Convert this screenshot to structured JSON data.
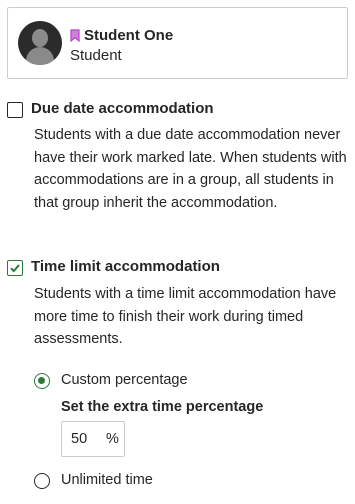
{
  "user": {
    "name": "Student One",
    "role": "Student",
    "bookmark_color": "#b045c2"
  },
  "due_date": {
    "title": "Due date accommodation",
    "checked": false,
    "description": "Students with a due date accommodation never have their work marked late. When students with accommodations are in a group, all students in that group inherit the accommodation."
  },
  "time_limit": {
    "title": "Time limit accommodation",
    "checked": true,
    "description": "Students with a time limit accommodation have more time to finish their work during timed assessments.",
    "options": [
      {
        "label": "Custom percentage",
        "selected": true
      },
      {
        "label": "Unlimited time",
        "selected": false
      }
    ],
    "extra_time_label": "Set the extra time percentage",
    "extra_time_value": "50",
    "extra_time_unit": "%"
  },
  "colors": {
    "accent": "#2b7a3c",
    "text": "#262626",
    "border": "#cdcdcd"
  }
}
